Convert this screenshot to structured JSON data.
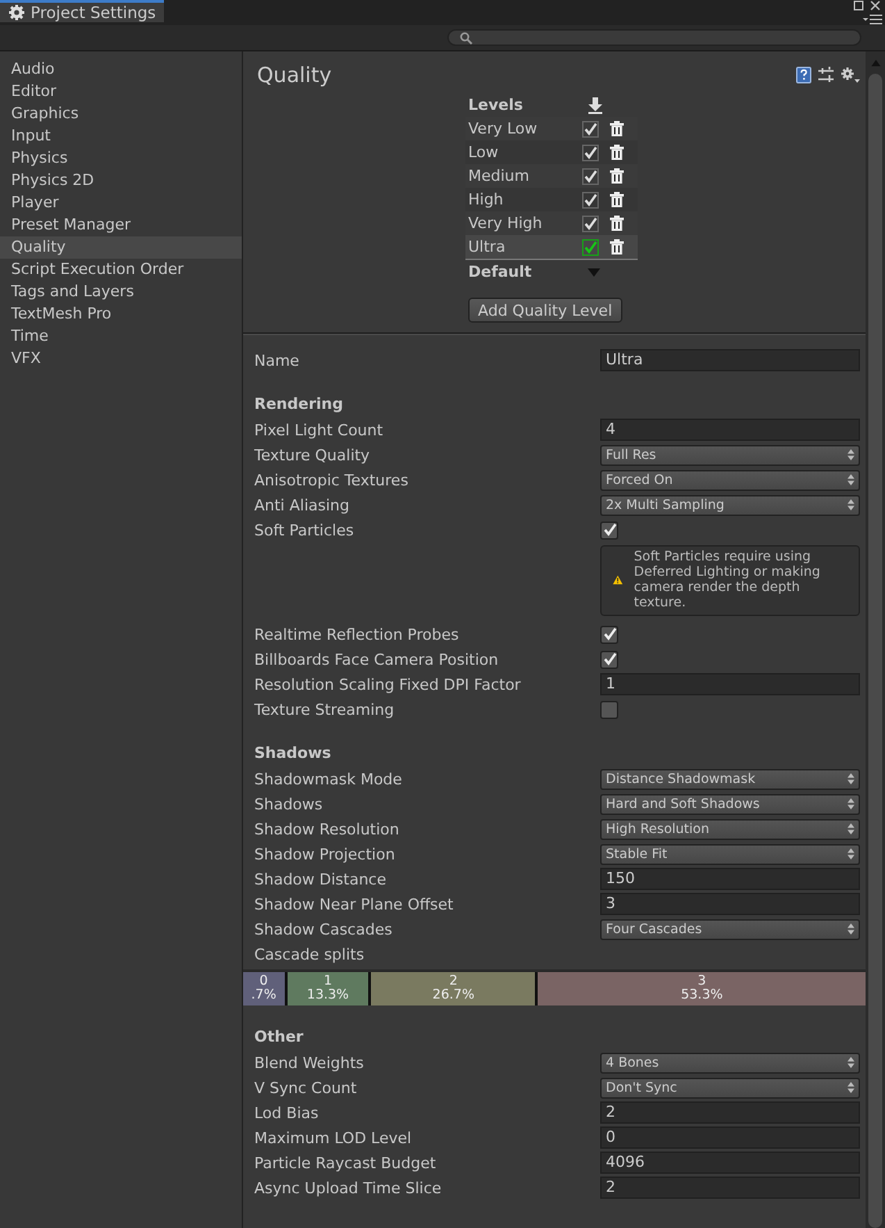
{
  "window": {
    "title": "Project Settings"
  },
  "sidebar": {
    "items": [
      {
        "label": "Audio",
        "selected": false
      },
      {
        "label": "Editor",
        "selected": false
      },
      {
        "label": "Graphics",
        "selected": false
      },
      {
        "label": "Input",
        "selected": false
      },
      {
        "label": "Physics",
        "selected": false
      },
      {
        "label": "Physics 2D",
        "selected": false
      },
      {
        "label": "Player",
        "selected": false
      },
      {
        "label": "Preset Manager",
        "selected": false
      },
      {
        "label": "Quality",
        "selected": true
      },
      {
        "label": "Script Execution Order",
        "selected": false
      },
      {
        "label": "Tags and Layers",
        "selected": false
      },
      {
        "label": "TextMesh Pro",
        "selected": false
      },
      {
        "label": "Time",
        "selected": false
      },
      {
        "label": "VFX",
        "selected": false
      }
    ]
  },
  "page_title": "Quality",
  "levels": {
    "heading": "Levels",
    "default_label": "Default",
    "add_button": "Add Quality Level",
    "items": [
      {
        "name": "Very Low",
        "checked": true,
        "selected": false
      },
      {
        "name": "Low",
        "checked": true,
        "selected": false
      },
      {
        "name": "Medium",
        "checked": true,
        "selected": false
      },
      {
        "name": "High",
        "checked": true,
        "selected": false
      },
      {
        "name": "Very High",
        "checked": true,
        "selected": false
      },
      {
        "name": "Ultra",
        "checked": true,
        "selected": true
      }
    ]
  },
  "name_field": {
    "label": "Name",
    "value": "Ultra"
  },
  "sections": [
    {
      "title": "Rendering",
      "rows": [
        {
          "kind": "field",
          "label": "Pixel Light Count",
          "value": "4"
        },
        {
          "kind": "dropdown",
          "label": "Texture Quality",
          "value": "Full Res"
        },
        {
          "kind": "dropdown",
          "label": "Anisotropic Textures",
          "value": "Forced On"
        },
        {
          "kind": "dropdown",
          "label": "Anti Aliasing",
          "value": "2x Multi Sampling"
        },
        {
          "kind": "checkbox",
          "label": "Soft Particles",
          "checked": true
        },
        {
          "kind": "warning",
          "text": "Soft Particles require using Deferred Lighting or making camera render the depth texture."
        },
        {
          "kind": "checkbox",
          "label": "Realtime Reflection Probes",
          "checked": true
        },
        {
          "kind": "checkbox",
          "label": "Billboards Face Camera Position",
          "checked": true
        },
        {
          "kind": "field",
          "label": "Resolution Scaling Fixed DPI Factor",
          "value": "1"
        },
        {
          "kind": "checkbox",
          "label": "Texture Streaming",
          "checked": false
        }
      ]
    },
    {
      "title": "Shadows",
      "rows": [
        {
          "kind": "dropdown",
          "label": "Shadowmask Mode",
          "value": "Distance Shadowmask"
        },
        {
          "kind": "dropdown",
          "label": "Shadows",
          "value": "Hard and Soft Shadows"
        },
        {
          "kind": "dropdown",
          "label": "Shadow Resolution",
          "value": "High Resolution"
        },
        {
          "kind": "dropdown",
          "label": "Shadow Projection",
          "value": "Stable Fit"
        },
        {
          "kind": "field",
          "label": "Shadow Distance",
          "value": "150"
        },
        {
          "kind": "field",
          "label": "Shadow Near Plane Offset",
          "value": "3"
        },
        {
          "kind": "dropdown",
          "label": "Shadow Cascades",
          "value": "Four Cascades"
        },
        {
          "kind": "label",
          "label": "Cascade splits"
        },
        {
          "kind": "cascades",
          "splits": [
            {
              "index": "0",
              "percent": ".7%",
              "level": 0.067,
              "color": "#60607a"
            },
            {
              "index": "1",
              "percent": "13.3%",
              "level": 0.133,
              "color": "#5f7a5f"
            },
            {
              "index": "2",
              "percent": "26.7%",
              "level": 0.267,
              "color": "#7a7a60"
            },
            {
              "index": "3",
              "percent": "53.3%",
              "level": 0.533,
              "color": "#7a6464"
            }
          ]
        }
      ]
    },
    {
      "title": "Other",
      "rows": [
        {
          "kind": "dropdown",
          "label": "Blend Weights",
          "value": "4 Bones"
        },
        {
          "kind": "dropdown",
          "label": "V Sync Count",
          "value": "Don't Sync"
        },
        {
          "kind": "field",
          "label": "Lod Bias",
          "value": "2"
        },
        {
          "kind": "field",
          "label": "Maximum LOD Level",
          "value": "0"
        },
        {
          "kind": "field",
          "label": "Particle Raycast Budget",
          "value": "4096"
        },
        {
          "kind": "field",
          "label": "Async Upload Time Slice",
          "value": "2"
        }
      ]
    }
  ]
}
